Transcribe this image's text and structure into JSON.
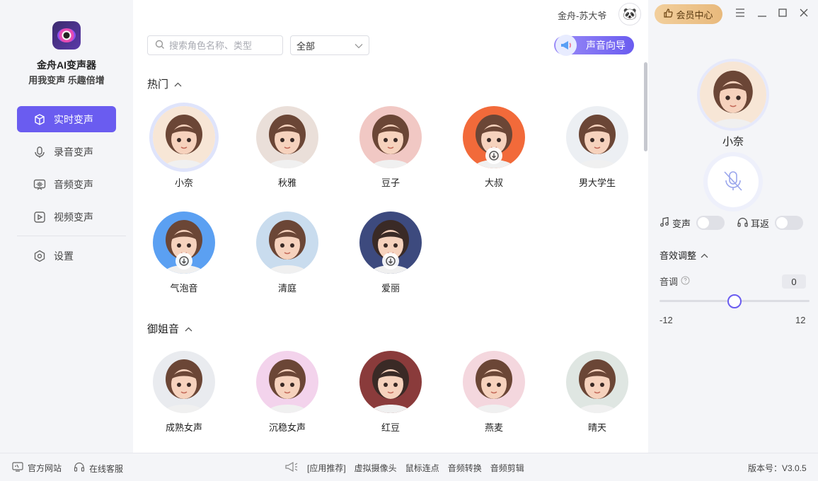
{
  "app": {
    "name": "金舟AI变声器",
    "slogan": "用我变声 乐趣倍增"
  },
  "sidebar": {
    "items": [
      {
        "label": "实时变声",
        "icon": "cube-icon",
        "active": true
      },
      {
        "label": "录音变声",
        "icon": "microphone-icon"
      },
      {
        "label": "音频变声",
        "icon": "audio-wave-icon"
      },
      {
        "label": "视频变声",
        "icon": "video-play-icon"
      },
      {
        "label": "设置",
        "icon": "gear-icon"
      }
    ]
  },
  "header": {
    "user_name": "金舟-苏大爷",
    "vip_label": "会员中心"
  },
  "toolbar": {
    "search_placeholder": "搜索角色名称、类型",
    "filter_value": "全部",
    "guide_label": "声音向导"
  },
  "sections": [
    {
      "title": "热门",
      "voices": [
        {
          "name": "小奈",
          "selected": true,
          "download": false,
          "color": "#f7e6d6"
        },
        {
          "name": "秋雅",
          "download": false,
          "color": "#eadfd9"
        },
        {
          "name": "豆子",
          "download": false,
          "color": "#f1c8c4"
        },
        {
          "name": "大叔",
          "download": true,
          "color": "#f26a3a"
        },
        {
          "name": "男大学生",
          "download": false,
          "color": "#eceff3"
        },
        {
          "name": "气泡音",
          "download": true,
          "color": "#5ba0f2"
        },
        {
          "name": "清庭",
          "download": false,
          "color": "#c9dcee"
        },
        {
          "name": "爱丽",
          "download": true,
          "color": "#3d4a7e"
        }
      ]
    },
    {
      "title": "御姐音",
      "voices": [
        {
          "name": "成熟女声",
          "download": false,
          "color": "#e9ebef"
        },
        {
          "name": "沉稳女声",
          "download": false,
          "color": "#f3d3ec"
        },
        {
          "name": "红豆",
          "download": false,
          "color": "#8a3b3b"
        },
        {
          "name": "燕麦",
          "download": false,
          "color": "#f4d7de"
        },
        {
          "name": "晴天",
          "download": false,
          "color": "#dfe6e2"
        }
      ]
    }
  ],
  "right_panel": {
    "current_voice": "小奈",
    "voice_change_label": "变声",
    "ear_return_label": "耳返",
    "fx_title": "音效调整",
    "pitch_label": "音调",
    "pitch_value": "0",
    "pitch_min": "-12",
    "pitch_max": "12"
  },
  "footer": {
    "website": "官方网站",
    "support": "在线客服",
    "recommend_label": "[应用推荐]",
    "recommend_items": [
      "虚拟摄像头",
      "鼠标连点",
      "音频转换",
      "音频剪辑"
    ],
    "version": "版本号：V3.0.5"
  },
  "colors": {
    "accent": "#6a5cf0",
    "vip_gold": "#e8b97c"
  }
}
